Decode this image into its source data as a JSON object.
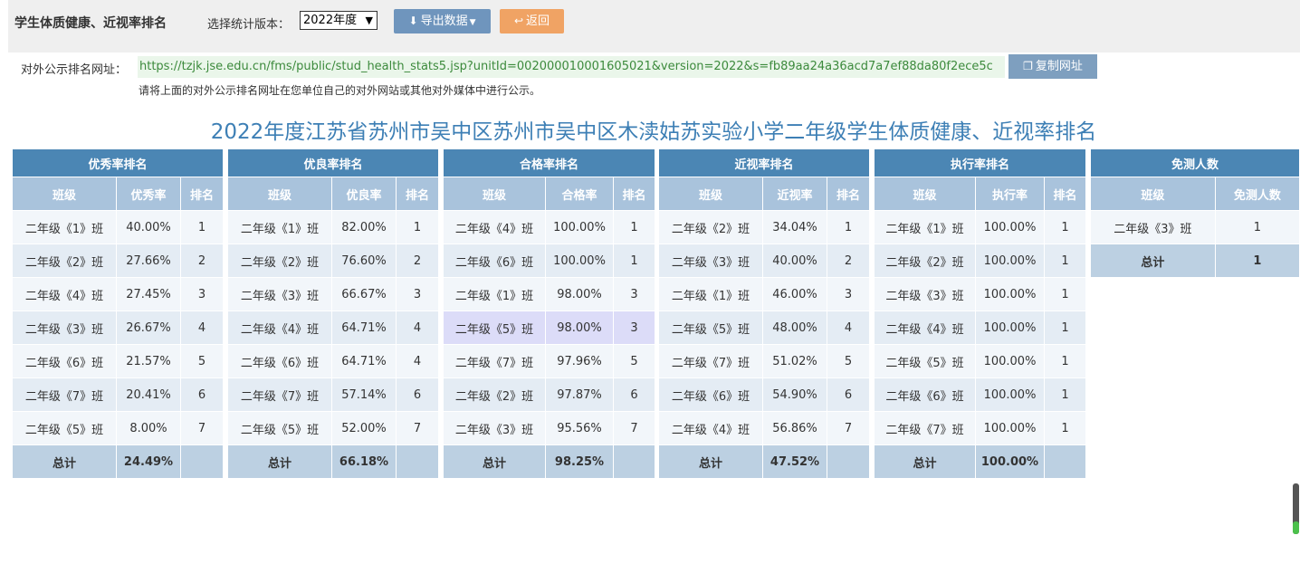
{
  "header": {
    "title": "学生体质健康、近视率排名",
    "version_label": "选择统计版本：",
    "version_value": "2022年度",
    "export_label": "导出数据",
    "back_label": "返回"
  },
  "share": {
    "label": "对外公示排名网址：",
    "url": "https://tzjk.jse.edu.cn/fms/public/stud_health_stats5.jsp?unitId=002000010001605021&version=2022&s=fb89aa24a36acd7a7ef88da80f2ece5c",
    "copy_label": "复制网址",
    "hint": "请将上面的对外公示排名网址在您单位自己的对外网站或其他对外媒体中进行公示。"
  },
  "report_title": "2022年度江苏省苏州市吴中区苏州市吴中区木渎姑苏实验小学二年级学生体质健康、近视率排名",
  "tables": [
    {
      "title": "优秀率排名",
      "headers": [
        "班级",
        "优秀率",
        "排名"
      ],
      "rows": [
        [
          "二年级《1》班",
          "40.00%",
          "1"
        ],
        [
          "二年级《2》班",
          "27.66%",
          "2"
        ],
        [
          "二年级《4》班",
          "27.45%",
          "3"
        ],
        [
          "二年级《3》班",
          "26.67%",
          "4"
        ],
        [
          "二年级《6》班",
          "21.57%",
          "5"
        ],
        [
          "二年级《7》班",
          "20.41%",
          "6"
        ],
        [
          "二年级《5》班",
          "8.00%",
          "7"
        ]
      ],
      "total": [
        "总计",
        "24.49%",
        ""
      ]
    },
    {
      "title": "优良率排名",
      "headers": [
        "班级",
        "优良率",
        "排名"
      ],
      "rows": [
        [
          "二年级《1》班",
          "82.00%",
          "1"
        ],
        [
          "二年级《2》班",
          "76.60%",
          "2"
        ],
        [
          "二年级《3》班",
          "66.67%",
          "3"
        ],
        [
          "二年级《4》班",
          "64.71%",
          "4"
        ],
        [
          "二年级《6》班",
          "64.71%",
          "4"
        ],
        [
          "二年级《7》班",
          "57.14%",
          "6"
        ],
        [
          "二年级《5》班",
          "52.00%",
          "7"
        ]
      ],
      "total": [
        "总计",
        "66.18%",
        ""
      ]
    },
    {
      "title": "合格率排名",
      "headers": [
        "班级",
        "合格率",
        "排名"
      ],
      "rows": [
        [
          "二年级《4》班",
          "100.00%",
          "1"
        ],
        [
          "二年级《6》班",
          "100.00%",
          "1"
        ],
        [
          "二年级《1》班",
          "98.00%",
          "3"
        ],
        [
          "二年级《5》班",
          "98.00%",
          "3"
        ],
        [
          "二年级《7》班",
          "97.96%",
          "5"
        ],
        [
          "二年级《2》班",
          "97.87%",
          "6"
        ],
        [
          "二年级《3》班",
          "95.56%",
          "7"
        ]
      ],
      "total": [
        "总计",
        "98.25%",
        ""
      ]
    },
    {
      "title": "近视率排名",
      "headers": [
        "班级",
        "近视率",
        "排名"
      ],
      "rows": [
        [
          "二年级《2》班",
          "34.04%",
          "1"
        ],
        [
          "二年级《3》班",
          "40.00%",
          "2"
        ],
        [
          "二年级《1》班",
          "46.00%",
          "3"
        ],
        [
          "二年级《5》班",
          "48.00%",
          "4"
        ],
        [
          "二年级《7》班",
          "51.02%",
          "5"
        ],
        [
          "二年级《6》班",
          "54.90%",
          "6"
        ],
        [
          "二年级《4》班",
          "56.86%",
          "7"
        ]
      ],
      "total": [
        "总计",
        "47.52%",
        ""
      ]
    },
    {
      "title": "执行率排名",
      "headers": [
        "班级",
        "执行率",
        "排名"
      ],
      "rows": [
        [
          "二年级《1》班",
          "100.00%",
          "1"
        ],
        [
          "二年级《2》班",
          "100.00%",
          "1"
        ],
        [
          "二年级《3》班",
          "100.00%",
          "1"
        ],
        [
          "二年级《4》班",
          "100.00%",
          "1"
        ],
        [
          "二年级《5》班",
          "100.00%",
          "1"
        ],
        [
          "二年级《6》班",
          "100.00%",
          "1"
        ],
        [
          "二年级《7》班",
          "100.00%",
          "1"
        ]
      ],
      "total": [
        "总计",
        "100.00%",
        ""
      ]
    },
    {
      "title": "免测人数",
      "headers": [
        "班级",
        "免测人数"
      ],
      "rows": [
        [
          "二年级《3》班",
          "1"
        ]
      ],
      "total": [
        "总计",
        "1"
      ]
    }
  ]
}
